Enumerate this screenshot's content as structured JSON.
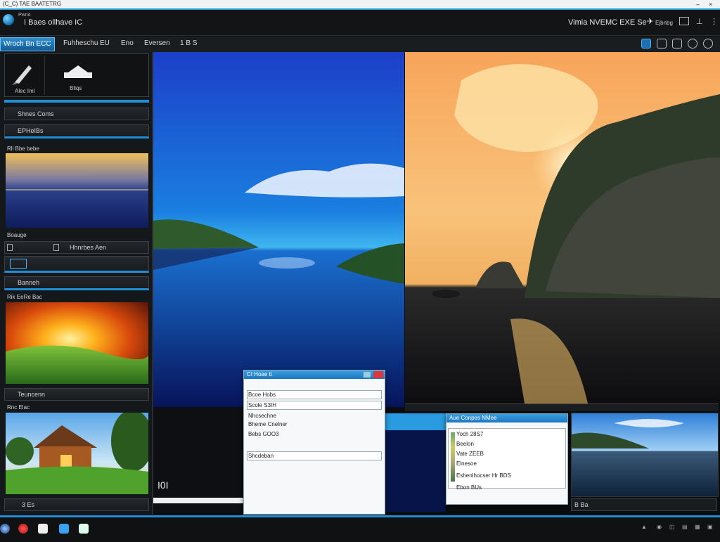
{
  "titlebar": {
    "text": "(C_C)  TAE  BAATETRG"
  },
  "header": {
    "app_small": "Pwno",
    "app_name": "I  Baes ollhave IC",
    "right_text": "Vimia NVEMC  EXE  Se",
    "icon_sel": "Ejbnbg"
  },
  "tabs": {
    "active": "Wroch Bn ECC",
    "items": [
      "Fuhheschu",
      "EU",
      "Eno",
      "Eversen",
      "1  B  S"
    ]
  },
  "left_panel": {
    "top_card": {
      "item1": "Alec Iml",
      "item2": "Bliqs"
    },
    "bar1": "Shnes Coms",
    "bar2": "EPHeIBs",
    "section1_label": "Rli Bbe bebe",
    "section1_footer": "Boauge",
    "bar3": "Hhnrbes Aen",
    "bar4": "",
    "bar5": "Banneh",
    "section2_label": "Rik  EeRe Bac",
    "section2_footer": "Teuncenn",
    "section3_label": "Rnc Elac",
    "bottom_bar": "3   Es"
  },
  "center": {
    "overlay_text": "I0I"
  },
  "dialog1": {
    "title": "CI Hoae  tt",
    "rows": [
      "Bcoe Hobs",
      "Scole S3IH",
      "Nhcsechne",
      "Bheme Cnelner",
      "Bebs GOO3",
      "Shcdeban"
    ]
  },
  "dialog2": {
    "title": "Aue Conpes  NMee",
    "rows": [
      "Yoch 28S7",
      "Beelon",
      "Vate ZEEB",
      "Elnesoe",
      "Eshenlhocser Hr  BDS",
      "Ebon BUs"
    ]
  },
  "bottom_right": {
    "label": "B  Ba"
  },
  "taskbar": {
    "items": [
      "browser",
      "chrome",
      "explorer",
      "store",
      "files"
    ]
  },
  "colors": {
    "accent": "#1e8fd6",
    "dark_bg": "#0b0c0e"
  }
}
